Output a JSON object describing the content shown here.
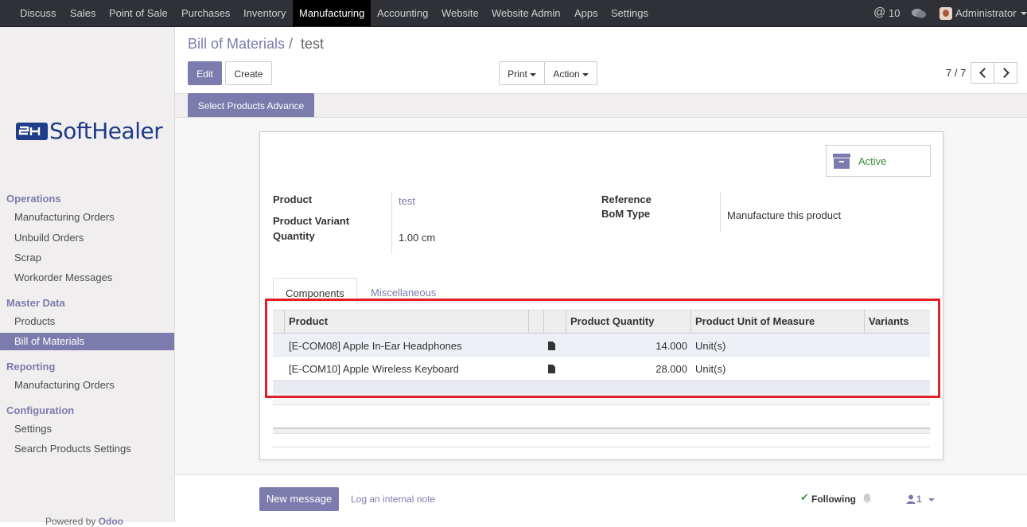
{
  "topbar": {
    "menus": [
      "Discuss",
      "Sales",
      "Point of Sale",
      "Purchases",
      "Inventory",
      "Manufacturing",
      "Accounting",
      "Website",
      "Website Admin",
      "Apps",
      "Settings"
    ],
    "active_menu": "Manufacturing",
    "mentions_count": "10",
    "user_name": "Administrator"
  },
  "sidebar": {
    "logo_text": "SoftHealer",
    "sections": [
      {
        "title": "Operations",
        "items": [
          "Manufacturing Orders",
          "Unbuild Orders",
          "Scrap",
          "Workorder Messages"
        ]
      },
      {
        "title": "Master Data",
        "items": [
          "Products",
          "Bill of Materials"
        ]
      },
      {
        "title": "Reporting",
        "items": [
          "Manufacturing Orders"
        ]
      },
      {
        "title": "Configuration",
        "items": [
          "Settings",
          "Search Products Settings"
        ]
      }
    ],
    "active_item": "Bill of Materials",
    "powered_by": "Powered by",
    "powered_brand": "Odoo"
  },
  "control_panel": {
    "breadcrumb_parent": "Bill of Materials",
    "breadcrumb_sep": "/",
    "breadcrumb_current": "test",
    "edit_label": "Edit",
    "create_label": "Create",
    "print_label": "Print",
    "action_label": "Action",
    "pager": "7 / 7",
    "select_products_label": "Select Products Advance"
  },
  "form": {
    "active_button_label": "Active",
    "fields": {
      "product_label": "Product",
      "product_value": "test",
      "variant_label": "Product Variant",
      "quantity_label": "Quantity",
      "quantity_value": "1.00 cm",
      "reference_label": "Reference",
      "bom_type_label": "BoM Type",
      "bom_type_value": "Manufacture this product"
    },
    "tabs": [
      "Components",
      "Miscellaneous"
    ],
    "table": {
      "headers": [
        "Product",
        "Product Quantity",
        "Product Unit of Measure",
        "Variants"
      ],
      "rows": [
        {
          "product": "[E-COM08] Apple In-Ear Headphones",
          "qty": "14.000",
          "uom": "Unit(s)"
        },
        {
          "product": "[E-COM10] Apple Wireless Keyboard",
          "qty": "28.000",
          "uom": "Unit(s)"
        }
      ]
    }
  },
  "chatter": {
    "new_message_label": "New message",
    "log_note_label": "Log an internal note",
    "following_label": "Following",
    "followers_count": "1"
  },
  "colors": {
    "accent": "#7c7bad",
    "highlight": "#e31e24",
    "navbar": "#2f3136",
    "active_green": "#3a8a3a"
  }
}
